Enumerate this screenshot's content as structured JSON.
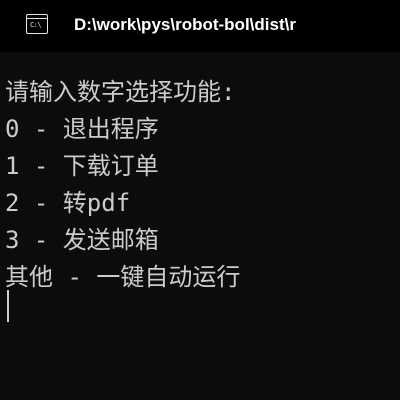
{
  "window": {
    "title": "D:\\work\\pys\\robot-bol\\dist\\r",
    "icon": "console-icon",
    "icon_glyph": "C:\\"
  },
  "console": {
    "lines": [
      "请输入数字选择功能:",
      "0 - 退出程序",
      "1 - 下载订单",
      "2 - 转pdf",
      "3 - 发送邮箱",
      "其他 - 一键自动运行"
    ]
  },
  "colors": {
    "background": "#0c0c0c",
    "titlebar": "#000000",
    "text": "#cccccc",
    "title_text": "#ffffff"
  }
}
